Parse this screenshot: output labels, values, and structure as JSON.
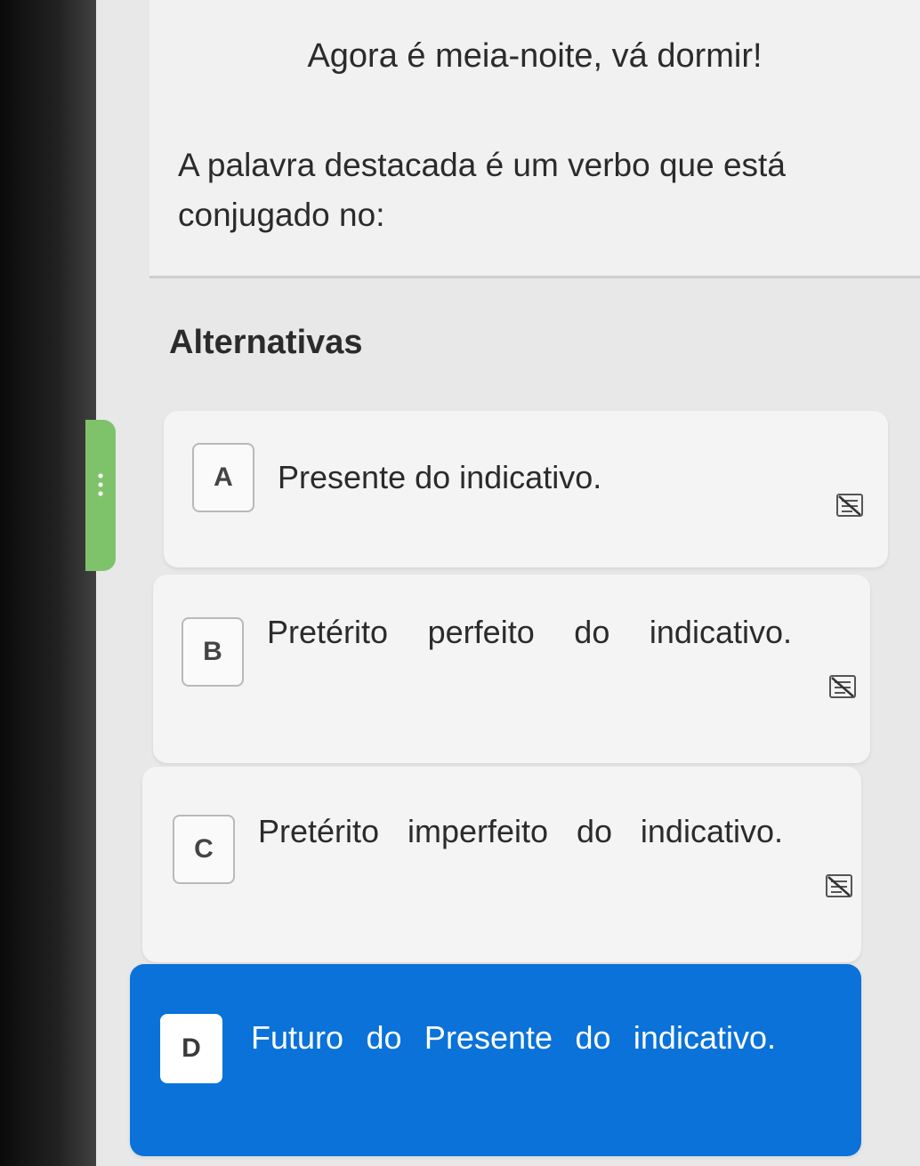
{
  "question": {
    "sentence": "Agora é meia-noite, vá dormir!",
    "prompt": "A palavra destacada é um verbo que está conjugado no:"
  },
  "alternatives": {
    "title": "Alternativas",
    "options": [
      {
        "letter": "A",
        "text": "Presente do indicativo."
      },
      {
        "letter": "B",
        "text": "Pretérito perfeito do indicativo."
      },
      {
        "letter": "C",
        "text": "Pretérito imperfeito do indicativo."
      },
      {
        "letter": "D",
        "text": "Futuro do Presente do indicativo."
      }
    ],
    "selected": "D"
  },
  "icons": {
    "eliminate": "strike-option-icon",
    "handle": "drag-handle-icon"
  },
  "colors": {
    "selected": "#0a72d8",
    "tab": "#7ec36a"
  }
}
